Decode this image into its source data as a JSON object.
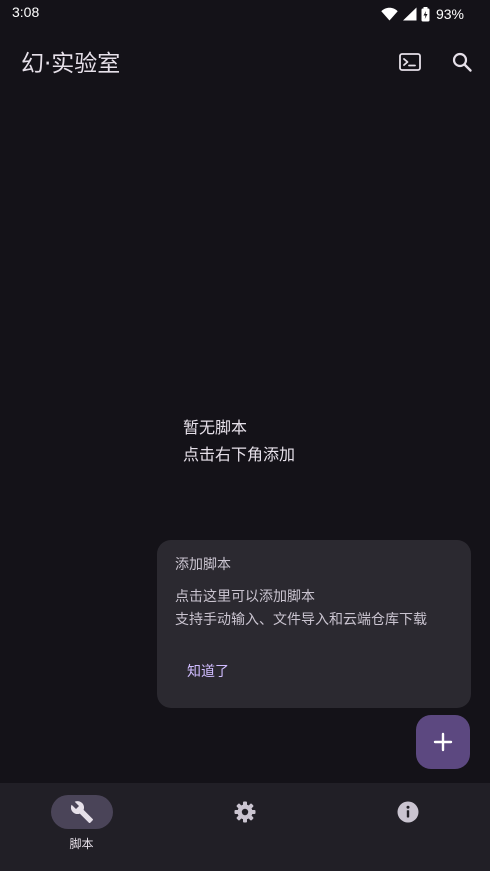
{
  "status_bar": {
    "time": "3:08",
    "battery": "93%"
  },
  "app_bar": {
    "title": "幻·实验室",
    "icons": [
      "terminal-icon",
      "search-icon"
    ]
  },
  "empty_state": {
    "line1": "暂无脚本",
    "line2": "点击右下角添加"
  },
  "tooltip": {
    "title": "添加脚本",
    "line1": "点击这里可以添加脚本",
    "line2": "支持手动输入、文件导入和云端仓库下载",
    "action": "知道了"
  },
  "fab": {
    "icon": "plus-icon"
  },
  "bottom_nav": {
    "items": [
      {
        "icon": "wrench-icon",
        "label": "脚本",
        "active": true
      },
      {
        "icon": "gear-icon",
        "label": "",
        "active": false
      },
      {
        "icon": "info-icon",
        "label": "",
        "active": false
      }
    ]
  },
  "colors": {
    "background": "#141218",
    "surface": "#211F26",
    "tooltip_bg": "#2B2930",
    "primary": "#D0BCFF",
    "fab": "#5C4880",
    "nav_indicator": "#4A4458"
  }
}
